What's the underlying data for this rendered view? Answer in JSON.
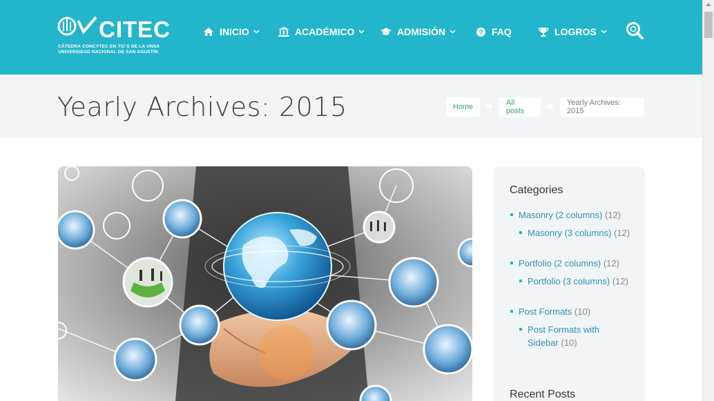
{
  "header": {
    "logo_text": "CITEC",
    "logo_sub1": "CÁTEDRA CONCYTEC EN TIC'S DE LA UNSA",
    "logo_sub2": "UNIVERSIDAD NACIONAL DE SAN AGUSTÍN",
    "nav": [
      {
        "label": "INICIO",
        "icon": "home-icon",
        "dropdown": true
      },
      {
        "label": "ACADÉMICO",
        "icon": "bank-icon",
        "dropdown": true
      },
      {
        "label": "ADMISIÓN",
        "icon": "graduation-cap-icon",
        "dropdown": true
      },
      {
        "label": "FAQ",
        "icon": "question-circle-icon",
        "dropdown": false
      },
      {
        "label": "LOGROS",
        "icon": "trophy-icon",
        "dropdown": true
      }
    ],
    "search_icon": "search-icon",
    "colors": {
      "brand": "#23b5cc"
    }
  },
  "page": {
    "title": "Yearly Archives: 2015",
    "breadcrumb": [
      "Home",
      "All posts",
      "Yearly Archives: 2015"
    ]
  },
  "featured_image": "globe-network-hand",
  "sidebar": {
    "categories_title": "Categories",
    "categories": [
      {
        "label": "Masonry (2 columns)",
        "count": "(12)",
        "level": 0
      },
      {
        "label": "Masonry (3 columns)",
        "count": "(12)",
        "level": 1
      },
      {
        "label": "Portfolio (2 columns)",
        "count": "(12)",
        "level": 0
      },
      {
        "label": "Portfolio (3 columns)",
        "count": "(12)",
        "level": 1
      },
      {
        "label": "Post Formats",
        "count": "(10)",
        "level": 0
      },
      {
        "label": "Post Formats with Sidebar",
        "count": "(10)",
        "level": 1
      }
    ],
    "recent_title": "Recent Posts"
  }
}
